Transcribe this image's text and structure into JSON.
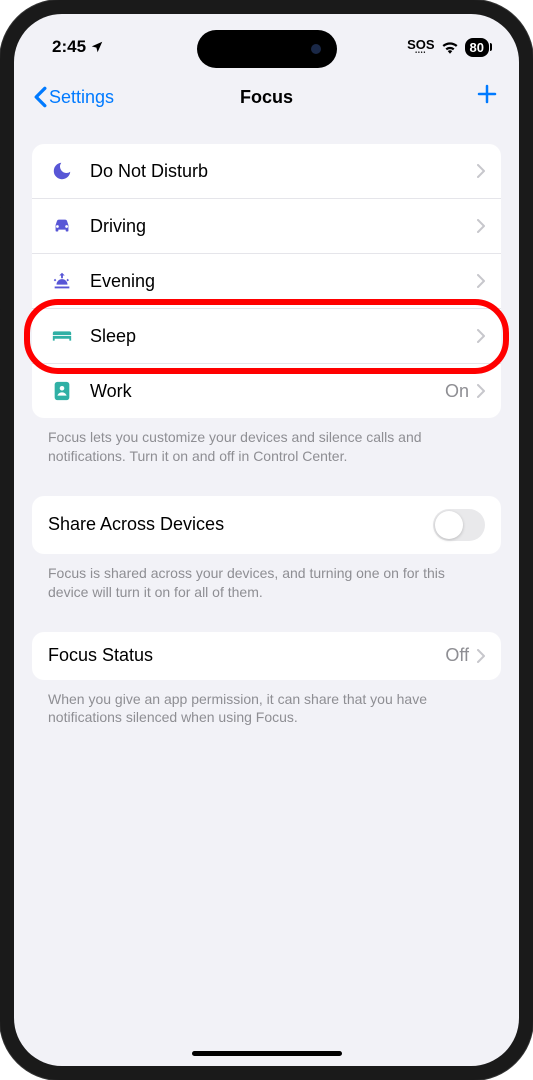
{
  "statusBar": {
    "time": "2:45",
    "sos": "SOS",
    "battery": "80"
  },
  "nav": {
    "back": "Settings",
    "title": "Focus"
  },
  "focusModes": [
    {
      "label": "Do Not Disturb",
      "iconColor": "#5856d6",
      "value": ""
    },
    {
      "label": "Driving",
      "iconColor": "#5856d6",
      "value": ""
    },
    {
      "label": "Evening",
      "iconColor": "#5856d6",
      "value": ""
    },
    {
      "label": "Sleep",
      "iconColor": "#30b0a5",
      "value": ""
    },
    {
      "label": "Work",
      "iconColor": "#30b0a5",
      "value": "On"
    }
  ],
  "focusFooter": "Focus lets you customize your devices and silence calls and notifications. Turn it on and off in Control Center.",
  "shareSection": {
    "label": "Share Across Devices",
    "footer": "Focus is shared across your devices, and turning one on for this device will turn it on for all of them."
  },
  "statusSection": {
    "label": "Focus Status",
    "value": "Off",
    "footer": "When you give an app permission, it can share that you have notifications silenced when using Focus."
  },
  "highlight": {
    "rowIndex": 3
  }
}
